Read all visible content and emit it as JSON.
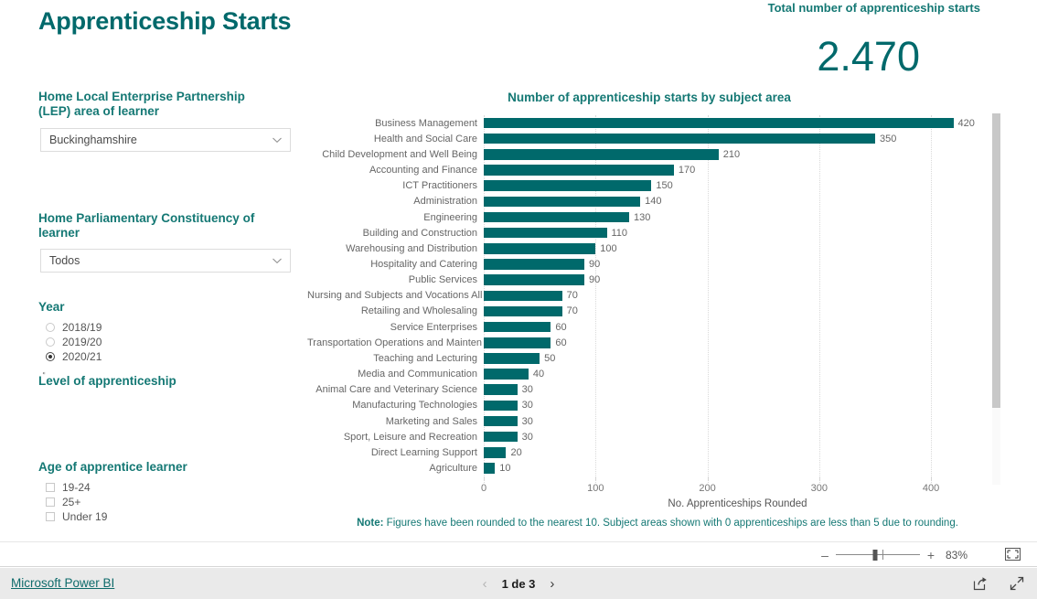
{
  "report": {
    "title": "Apprenticeship Starts"
  },
  "kpi": {
    "label": "Total number of apprenticeship starts",
    "value": "2.470"
  },
  "slicers": {
    "lep": {
      "title": "Home Local Enterprise Partnership (LEP) area of learner",
      "selected": "Buckinghamshire",
      "chevron_icon": "chevron-down-icon"
    },
    "constituency": {
      "title": "Home Parliamentary Constituency of learner",
      "selected": "Todos",
      "chevron_icon": "chevron-down-icon"
    },
    "year": {
      "title": "Year",
      "options": [
        {
          "label": "2018/19",
          "selected": false
        },
        {
          "label": "2019/20",
          "selected": false
        },
        {
          "label": "2020/21",
          "selected": true
        }
      ]
    },
    "level": {
      "title": "Level of apprenticeship",
      "options": []
    },
    "age": {
      "title": "Age of apprentice learner",
      "options": [
        {
          "label": "19-24",
          "checked": false
        },
        {
          "label": "25+",
          "checked": false
        },
        {
          "label": "Under 19",
          "checked": false
        }
      ]
    }
  },
  "chart_data": {
    "type": "bar",
    "orientation": "horizontal",
    "title": "Number of apprenticeship starts by subject area",
    "xlabel": "No. Apprenticeships Rounded",
    "ylabel": "",
    "xlim": [
      0,
      440
    ],
    "xticks": [
      0,
      100,
      200,
      300,
      400
    ],
    "grid": true,
    "legend": false,
    "note": "Figures have been rounded to the nearest 10. Subject areas shown with 0 apprenticeships are less than 5 due to rounding.",
    "note_prefix": "Note:",
    "bar_color": "#00696B",
    "categories": [
      "Business Management",
      "Health and Social Care",
      "Child Development and Well Being",
      "Accounting and Finance",
      "ICT Practitioners",
      "Administration",
      "Engineering",
      "Building and Construction",
      "Warehousing and Distribution",
      "Hospitality and Catering",
      "Public Services",
      "Nursing and Subjects and Vocations Alli...",
      "Retailing and Wholesaling",
      "Service Enterprises",
      "Transportation Operations and Mainten...",
      "Teaching and Lecturing",
      "Media and Communication",
      "Animal Care and Veterinary Science",
      "Manufacturing Technologies",
      "Marketing and Sales",
      "Sport, Leisure and Recreation",
      "Direct Learning Support",
      "Agriculture"
    ],
    "values": [
      420,
      350,
      210,
      170,
      150,
      140,
      130,
      110,
      100,
      90,
      90,
      70,
      70,
      60,
      60,
      50,
      40,
      30,
      30,
      30,
      30,
      20,
      10
    ]
  },
  "statusbar": {
    "zoom_minus": "–",
    "zoom_plus": "+",
    "zoom_percent": "83%",
    "fit_icon": "fit-to-page-icon"
  },
  "footer": {
    "brand": "Microsoft Power BI",
    "prev_icon": "chevron-left-icon",
    "next_icon": "chevron-right-icon",
    "page_label": "1 de 3",
    "share_icon": "share-icon",
    "fullscreen_icon": "fullscreen-icon"
  },
  "colors": {
    "brand_teal": "#00696B",
    "label_teal": "#147874",
    "bar": "#00696B"
  }
}
